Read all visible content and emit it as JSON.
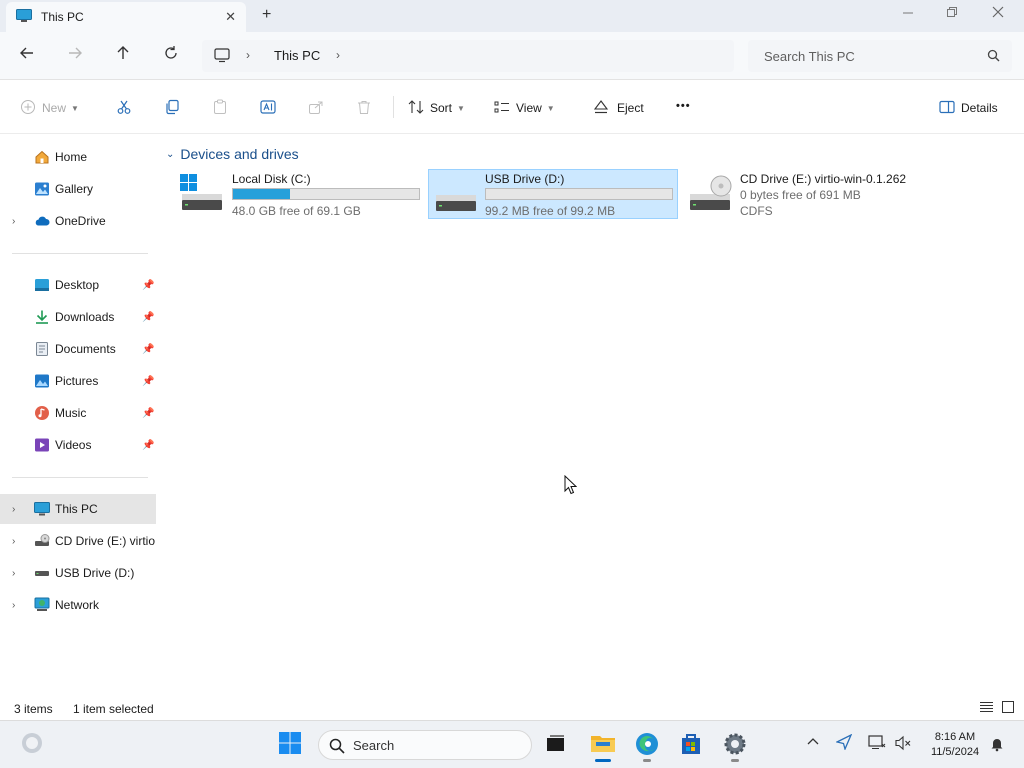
{
  "window": {
    "tab_title": "This PC",
    "tab_icon": "monitor-icon",
    "new_tab": "+",
    "close_tab": "✕"
  },
  "address": {
    "breadcrumb": [
      "This PC"
    ],
    "search_placeholder": "Search This PC"
  },
  "commands": {
    "new": "New",
    "sort": "Sort",
    "view": "View",
    "eject": "Eject",
    "more": "•••",
    "details": "Details"
  },
  "sidebar": {
    "quick": [
      {
        "label": "Home",
        "icon": "home-icon"
      },
      {
        "label": "Gallery",
        "icon": "gallery-icon"
      },
      {
        "label": "OneDrive",
        "icon": "cloud-icon"
      }
    ],
    "pinned": [
      {
        "label": "Desktop",
        "icon": "desktop-icon"
      },
      {
        "label": "Downloads",
        "icon": "download-icon"
      },
      {
        "label": "Documents",
        "icon": "documents-icon"
      },
      {
        "label": "Pictures",
        "icon": "pictures-icon"
      },
      {
        "label": "Music",
        "icon": "music-icon"
      },
      {
        "label": "Videos",
        "icon": "videos-icon"
      }
    ],
    "devices": [
      {
        "label": "This PC",
        "icon": "this-pc-icon"
      },
      {
        "label": "CD Drive (E:) virtio-",
        "icon": "cd-drive-icon"
      },
      {
        "label": "USB Drive (D:)",
        "icon": "usb-drive-icon"
      },
      {
        "label": "Network",
        "icon": "network-icon"
      }
    ]
  },
  "content": {
    "group_header": "Devices and drives",
    "drives": [
      {
        "name": "Local Disk (C:)",
        "free_text": "48.0 GB free of 69.1 GB",
        "used_fraction": 0.305,
        "icon": "local-disk-icon",
        "selected": false
      },
      {
        "name": "USB Drive (D:)",
        "free_text": "99.2 MB free of 99.2 MB",
        "used_fraction": 0.0,
        "icon": "usb-drive-icon",
        "selected": true
      },
      {
        "name": "CD Drive (E:) virtio-win-0.1.262",
        "free_text": "0 bytes free of 691 MB",
        "filesystem": "CDFS",
        "icon": "cd-drive-icon",
        "selected": false
      }
    ]
  },
  "status": {
    "items": "3 items",
    "selected": "1 item selected"
  },
  "taskbar": {
    "search_label": "Search",
    "time": "8:16 AM",
    "date": "11/5/2024"
  },
  "colors": {
    "accent": "#0067c0",
    "drive_fill": "#26a0da",
    "selection_bg": "#cce8ff",
    "group_header": "#1a4f8b"
  }
}
